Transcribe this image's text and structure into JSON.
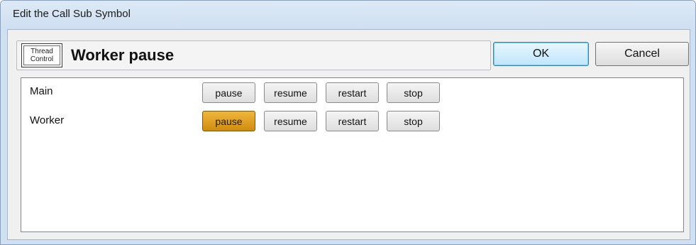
{
  "window": {
    "title": "Edit the Call Sub Symbol"
  },
  "symbol": {
    "icon_line1": "Thread",
    "icon_line2": "Control",
    "name": "Worker pause"
  },
  "dialog_buttons": {
    "ok_label": "OK",
    "cancel_label": "Cancel"
  },
  "rows": [
    {
      "label": "Main",
      "actions": [
        "pause",
        "resume",
        "restart",
        "stop"
      ],
      "selected": null
    },
    {
      "label": "Worker",
      "actions": [
        "pause",
        "resume",
        "restart",
        "stop"
      ],
      "selected": "pause"
    }
  ],
  "colors": {
    "selected_button": "#e0a020",
    "window_frame": "#cfe0f2",
    "ok_highlight": "#bee6fd"
  }
}
